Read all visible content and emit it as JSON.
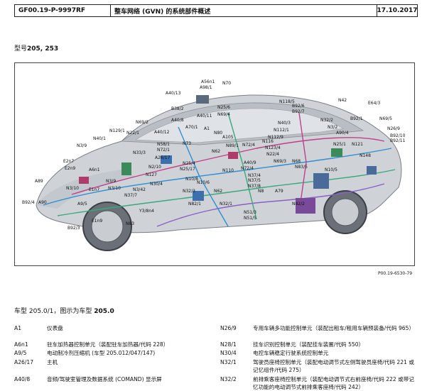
{
  "header": {
    "doc_no": "GF00.19-P-9997RF",
    "title": "整车网络 (GVN) 的系统部件概述",
    "date": "17.10.2017"
  },
  "model_line": {
    "prefix": "型号",
    "models": "205, 253"
  },
  "figure": {
    "id": "P00.19-6530-79",
    "labels": [
      "A56n1",
      "A98/1",
      "N70",
      "A40/13",
      "B38/2",
      "N25/6",
      "N69/4",
      "A40/8",
      "A40/11",
      "A70/1",
      "A1",
      "N118/5",
      "B92/6",
      "B92/7",
      "N42",
      "E64/3",
      "N32/2",
      "B92/1",
      "N69/5",
      "N26/9",
      "B92/10",
      "B92/11",
      "N69/2",
      "N129/1",
      "N40/1",
      "N22/1",
      "N40/3",
      "N3/2",
      "A40/12",
      "N112/1",
      "A90/4",
      "N25/1",
      "N121",
      "N148",
      "N3/9",
      "N72/4",
      "N72/1",
      "N58/1",
      "N80",
      "A105",
      "N89/1",
      "N116",
      "N112/9",
      "N123/4",
      "N62",
      "N33/3",
      "A26/17",
      "N73",
      "N22/4",
      "N69/3",
      "N68",
      "N83/5",
      "N10/5",
      "E2n7",
      "E2n9",
      "A6n1",
      "N2/10",
      "N127",
      "N25/4",
      "N25/17",
      "N110",
      "N72/4",
      "A40/9",
      "N37/4",
      "N37/5",
      "N37/8",
      "N8",
      "N10/8",
      "B92/4",
      "N3/10",
      "N3/9",
      "N3/10",
      "N30/4",
      "E1n7",
      "N3/42",
      "N37/7",
      "A9/5",
      "N32/3",
      "N62",
      "N82/1",
      "N32/1",
      "N51/3",
      "N51/5",
      "N82/2",
      "A79",
      "A89",
      "A90",
      "E1n9",
      "N83",
      "B92/3",
      "Y3/8n4",
      "N10/6"
    ]
  },
  "caption": {
    "text": "车型 205.0/1，图示为车型 ",
    "bold": "205.0"
  },
  "legend": [
    {
      "code": "A1",
      "desc": "仪表盘"
    },
    {
      "code": "A6n1",
      "desc": "驻车加热器控制单元（装配驻车加热器/代码 228）"
    },
    {
      "code": "A9/5",
      "desc": "电动制冷剂压缩机 (车型 205.012/047/147)"
    },
    {
      "code": "A26/17",
      "desc": "主机"
    },
    {
      "code": "A40/8",
      "desc": "音频/驾驶室管理及数据系统 (COMAND) 显示屏"
    },
    {
      "code": "N26/9",
      "desc": "专用车辆多功能控制单元（装配出租车/租用车辆预装备/代码 965）"
    },
    {
      "code": "N28/1",
      "desc": "挂车识别控制单元（装配挂车装置/代码 550）"
    },
    {
      "code": "N30/4",
      "desc": "电控车辆稳定行驶系统控制单元"
    },
    {
      "code": "N32/1",
      "desc": "驾驶员座椅控制单元（装配电动调节式左侧驾驶员座椅/代码 221 或记忆组件/代码 275）"
    },
    {
      "code": "N32/2",
      "desc": "前排乘客座椅控制单元（装配电动调节式右前座椅/代码 222 或带记忆功能的电动调节式前排乘客座椅/代码 242）"
    }
  ]
}
